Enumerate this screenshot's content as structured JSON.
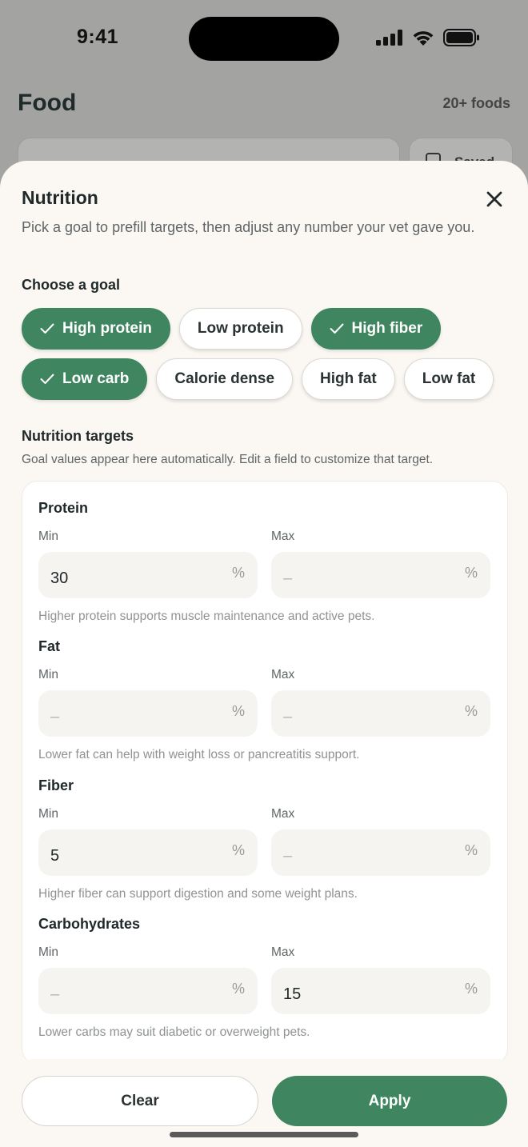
{
  "status": {
    "time": "9:41"
  },
  "background": {
    "title": "Food",
    "count": "20+ foods",
    "saved_label": "Saved"
  },
  "sheet": {
    "title": "Nutrition",
    "description": "Pick a goal to prefill targets, then adjust any number your vet gave you.",
    "goal_heading": "Choose a goal",
    "goals": [
      {
        "label": "High protein",
        "selected": true
      },
      {
        "label": "Low protein",
        "selected": false
      },
      {
        "label": "High fiber",
        "selected": true
      },
      {
        "label": "Low carb",
        "selected": true
      },
      {
        "label": "Calorie dense",
        "selected": false
      },
      {
        "label": "High fat",
        "selected": false
      },
      {
        "label": "Low fat",
        "selected": false
      }
    ],
    "targets_heading": "Nutrition targets",
    "targets_description": "Goal values appear here automatically. Edit a field to customize that target.",
    "min_label": "Min",
    "max_label": "Max",
    "empty_placeholder": "–",
    "unit": "%",
    "nutrients": [
      {
        "name": "Protein",
        "min": "30",
        "max": "",
        "hint": "Higher protein supports muscle maintenance and active pets."
      },
      {
        "name": "Fat",
        "min": "",
        "max": "",
        "hint": "Lower fat can help with weight loss or pancreatitis support."
      },
      {
        "name": "Fiber",
        "min": "5",
        "max": "",
        "hint": "Higher fiber can support digestion and some weight plans."
      },
      {
        "name": "Carbohydrates",
        "min": "",
        "max": "15",
        "hint": "Lower carbs may suit diabetic or overweight pets."
      }
    ],
    "clear_label": "Clear",
    "apply_label": "Apply"
  },
  "colors": {
    "accent": "#3f8660",
    "sheet_bg": "#fbf8f3",
    "scrim": "#a3a3a1"
  }
}
